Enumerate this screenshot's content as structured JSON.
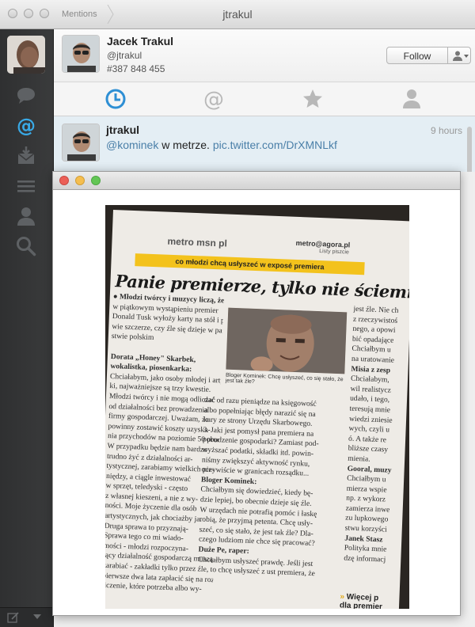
{
  "window": {
    "breadcrumb": "Mentions",
    "title": "jtrakul"
  },
  "sidebar": {
    "items": [
      {
        "icon": "speech-bubble-icon"
      },
      {
        "icon": "at-mention-icon",
        "active": true
      },
      {
        "icon": "messages-inbox-icon"
      },
      {
        "icon": "lists-icon"
      },
      {
        "icon": "profile-icon"
      },
      {
        "icon": "search-icon"
      }
    ]
  },
  "profile": {
    "name": "Jacek Trakul",
    "handle": "@jtrakul",
    "tweet_count": "#387 848 455",
    "follow_label": "Follow"
  },
  "tabs": [
    {
      "icon": "clock-icon",
      "active": true
    },
    {
      "icon": "at-icon"
    },
    {
      "icon": "star-icon"
    },
    {
      "icon": "person-icon"
    }
  ],
  "tweet": {
    "author": "jtrakul",
    "time": "9 hours",
    "mention": "@kominek",
    "text": " w metrze. ",
    "link": "pic.twitter.com/DrXMNLkf"
  },
  "newspaper": {
    "logo": "metro msn pl",
    "email": "metro@agora.pl",
    "email_sub": "Listy piszcie",
    "strap": "co młodzi chcą usłyszeć w exposé premiera",
    "headline": "Panie premierze, tylko nie ściemniaj!",
    "caption": "Bloger Kominek: Chcę usłyszeć, co się stało, że jest tak źle?",
    "col_left": [
      "● Młodzi twórcy i muzycy liczą, że",
      "w piątkowym wystąpieniu premier",
      "Donald Tusk wyłoży karty na stół i po-",
      "wie szczerze, czy źle się dzieje w pań-",
      "stwie polskim",
      "",
      "Dorata „Honey\" Skarbek,",
      "wokalistka, piosenkarka:",
      "Chciałabym, jako osoby młodej i artyst-",
      "ki, najważniejsze są trzy kwestie.",
      "Młodzi twórcy i nie mogą odliczać",
      "od działalności bez prowadzenia",
      "firmy gospodarczej. Uważam, że",
      "powinny zostawić koszty uzyska-",
      "nia przychodów na poziomie 50 proc.",
      "W przypadku będzie nam bardzo",
      "trudno żyć z działalności ar-",
      "tystycznej, zarabiamy wielkich pie-",
      "niędzy, a ciągle inwestować",
      "w sprzęt, teledyski - często",
      "z własnej kieszeni, a nie z wy-",
      "ności. Moje życzenie dla osób",
      "artystycznych, jak chociażby ja.",
      "Druga sprawa to przyznają-",
      "Sprawa tego co mi wiado-",
      "mości - młodzi rozpoczyna-",
      "jący działalność gospodarczą muszą",
      "zarabiać - zakładki tylko przez",
      "pierwsze dwa lata zapłacić się na roz-",
      "liczenie, które potrzeba albo wy-"
    ],
    "col_mid": [
      "dać od razu pieniądze na księgowość",
      "albo popełniając błędy narazić się na",
      "kary ze strony Urzędu Skarbowego.",
      "3. Jaki jest pomysł pana premiera na",
      "pobudzenie gospodarki? Zamiast pod-",
      "wyższać podatki, składki itd. powin-",
      "niśmy zwiększyć aktywność rynku,",
      "oczywiście w granicach rozsądku...",
      "Bloger Kominek:",
      "Chciałbym się dowiedzieć, kiedy bę-",
      "dzie lepiej, bo obecnie dzieje się źle.",
      "W urzędach nie potrafią pomóc i łaskę",
      "robią, że przyjmą petenta. Chcę usły-",
      "szeć, co się stało, że jest tak źle? Dla-",
      "czego ludziom nie chce się pracować?",
      "Duże Pe, raper:",
      "Chciałbym usłyszeć prawdę. Jeśli jest",
      "źle, to chcę usłyszeć z ust premiera, że"
    ],
    "col_right": [
      "jest źle. Nie ch",
      "z rzeczywistoś",
      "nego, a opowi",
      "bić opadające",
      "Chciałbym u",
      "na uratowanie",
      "Misia z zesp",
      "Chciałabym,",
      "wil realistycz",
      "udało, i tego,",
      "teresują mnie",
      "wiedzi zniesie",
      "wych, czyli u",
      "ó. A także re",
      "bliższe czasy",
      "mienia.",
      "Gooral, muzy",
      "Chciałbym u",
      "mierza wspie",
      "np. z wykorz",
      "zamierza inwe",
      "zu lupkowego",
      "stwu korzyści",
      "Janek Stasz",
      "Polityka mnie",
      "dzę informacj"
    ],
    "promo_arrows": "»",
    "promo_line1": "Więcej p",
    "promo_line2": "dla premier"
  }
}
